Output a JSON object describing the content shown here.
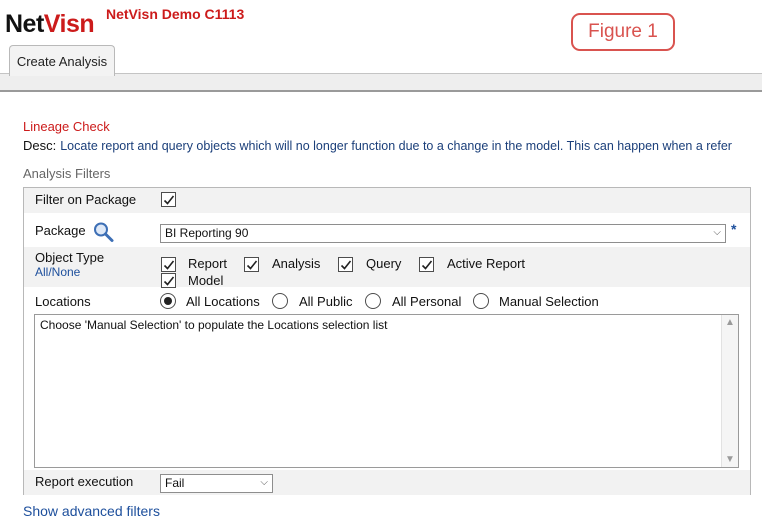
{
  "header": {
    "logo_part1": "Net",
    "logo_part2": "Visn",
    "demo_title": "NetVisn Demo C1113",
    "figure_label": "Figure 1"
  },
  "tabs": [
    {
      "label": "Create Analysis"
    }
  ],
  "analysis": {
    "name": "Lineage Check",
    "desc_label": "Desc:",
    "desc_text": "Locate report and query objects which will no longer function due to a change in the model. This can happen when a refer"
  },
  "filters": {
    "heading": "Analysis Filters",
    "filter_on_package": {
      "label": "Filter on Package",
      "checked": true
    },
    "package": {
      "label": "Package",
      "value": "BI Reporting 90",
      "required_mark": "*"
    },
    "object_type": {
      "label": "Object Type",
      "all_none_link": "All/None",
      "options": [
        {
          "label": "Report",
          "checked": true
        },
        {
          "label": "Analysis",
          "checked": true
        },
        {
          "label": "Query",
          "checked": true
        },
        {
          "label": "Active Report",
          "checked": true
        },
        {
          "label": "Model",
          "checked": true
        }
      ]
    },
    "locations": {
      "label": "Locations",
      "options": [
        {
          "label": "All Locations",
          "selected": true
        },
        {
          "label": "All Public",
          "selected": false
        },
        {
          "label": "All Personal",
          "selected": false
        },
        {
          "label": "Manual Selection",
          "selected": false
        }
      ],
      "list_hint": "Choose 'Manual Selection' to populate the Locations selection list"
    },
    "report_execution": {
      "label": "Report execution",
      "value": "Fail"
    }
  },
  "advanced_link": "Show advanced filters",
  "icons": {
    "package_search": "magnifier-icon",
    "dropdown": "chevron-down-icon",
    "scroll_up": "triangle-up-icon",
    "scroll_down": "triangle-down-icon"
  },
  "colors": {
    "brand_red": "#cc1b1b",
    "link_blue": "#1d4f9c",
    "figure_badge": "#d9534f"
  }
}
